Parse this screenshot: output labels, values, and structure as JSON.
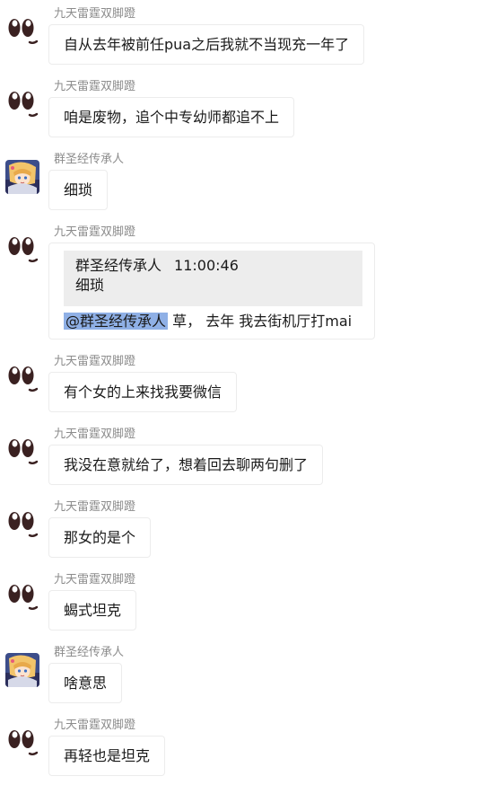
{
  "users": {
    "a": {
      "name": "九天雷霆双脚蹬",
      "avatar_icon": "eyes-avatar-icon"
    },
    "b": {
      "name": "群圣经传承人",
      "avatar_icon": "anime-girl-avatar-icon"
    }
  },
  "messages": [
    {
      "sender": "九天雷霆双脚蹬",
      "text": "自从去年被前任pua之后我就不当现充一年了"
    },
    {
      "sender": "九天雷霆双脚蹬",
      "text": "咱是废物，追个中专幼师都追不上"
    },
    {
      "sender": "群圣经传承人",
      "text": "细琐"
    },
    {
      "sender": "九天雷霆双脚蹬",
      "quote": {
        "author": "群圣经传承人",
        "time": "11:00:46",
        "text": "细琐"
      },
      "mention": "@群圣经传承人",
      "text": " 草， 去年 我去街机厅打mai"
    },
    {
      "sender": "九天雷霆双脚蹬",
      "text": "有个女的上来找我要微信"
    },
    {
      "sender": "九天雷霆双脚蹬",
      "text": "我没在意就给了，想着回去聊两句删了"
    },
    {
      "sender": "九天雷霆双脚蹬",
      "text": "那女的是个"
    },
    {
      "sender": "九天雷霆双脚蹬",
      "text": "蝎式坦克"
    },
    {
      "sender": "群圣经传承人",
      "text": "啥意思"
    },
    {
      "sender": "九天雷霆双脚蹬",
      "text": "再轻也是坦克"
    }
  ],
  "colors": {
    "sender_name": "#8c8c8c",
    "bubble_border": "#ececec",
    "quote_bg": "#ededed",
    "mention_bg": "#8fb0e6"
  }
}
